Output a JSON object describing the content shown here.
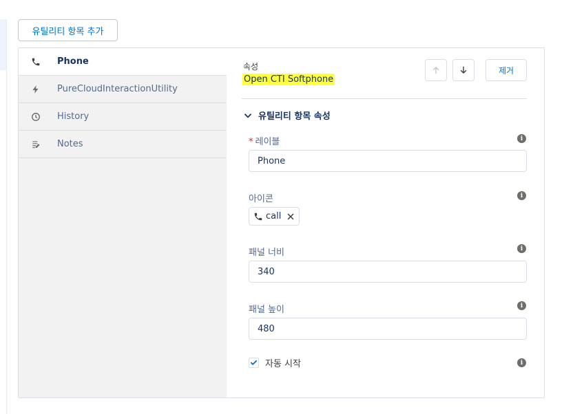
{
  "toolbar": {
    "add_label": "유틸리티 항목 추가"
  },
  "utility_items": [
    {
      "label": "Phone",
      "icon": "phone-icon"
    },
    {
      "label": "PureCloudInteractionUtility",
      "icon": "bolt-icon"
    },
    {
      "label": "History",
      "icon": "clock-icon"
    },
    {
      "label": "Notes",
      "icon": "notes-icon"
    }
  ],
  "properties": {
    "eyebrow": "속성",
    "title": "Open CTI Softphone",
    "highlight_color": "#ffff3a",
    "move_up_icon": "arrow-up-icon",
    "move_down_icon": "arrow-down-icon",
    "remove_label": "제거",
    "section_title": "유틸리티 항목 속성",
    "label_field": {
      "label": "레이블",
      "required_mark": "*",
      "value": "Phone"
    },
    "icon_field": {
      "label": "아이콘",
      "pill_value": "call",
      "pill_icon": "phone-icon"
    },
    "panel_width": {
      "label": "패널 너비",
      "value": "340"
    },
    "panel_height": {
      "label": "패널 높이",
      "value": "480"
    },
    "autostart": {
      "label": "자동 시작",
      "checked": true
    }
  },
  "colors": {
    "accent": "#0070d2",
    "text_dark": "#16325c",
    "border": "#d8dde6"
  }
}
